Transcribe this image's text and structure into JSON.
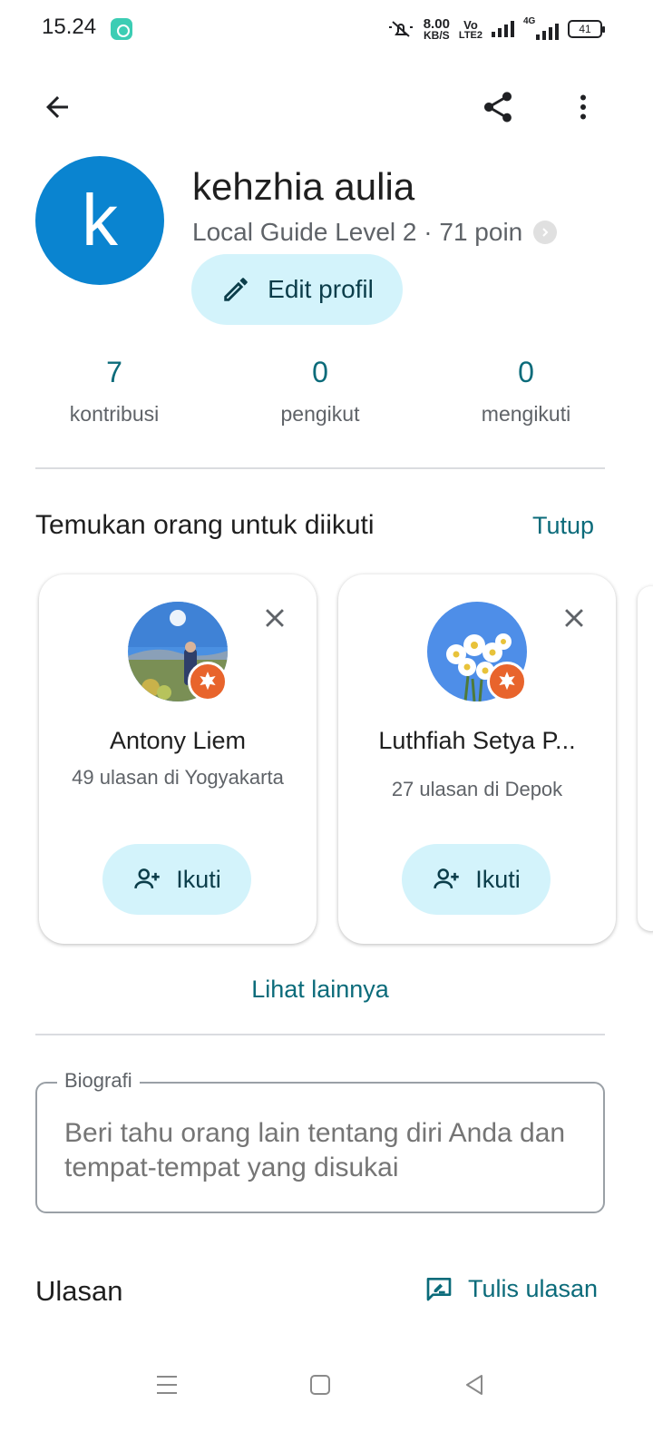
{
  "status_bar": {
    "time": "15.24",
    "net_speed_value": "8.00",
    "net_speed_unit": "KB/S",
    "volte_top": "Vo",
    "volte_bottom": "LTE2",
    "network_type": "4G",
    "battery": "41"
  },
  "profile": {
    "avatar_initial": "k",
    "name": "kehzhia aulia",
    "level": "Local Guide Level 2 · 71 poin",
    "edit_label": "Edit profil"
  },
  "stats": [
    {
      "value": "7",
      "label": "kontribusi"
    },
    {
      "value": "0",
      "label": "pengikut"
    },
    {
      "value": "0",
      "label": "mengikuti"
    }
  ],
  "suggestions": {
    "title": "Temukan orang untuk diikuti",
    "close_label": "Tutup",
    "more_label": "Lihat lainnya",
    "cards": [
      {
        "name": "Antony Liem",
        "subtitle": "49 ulasan di Yogyakarta",
        "follow_label": "Ikuti"
      },
      {
        "name": "Luthfiah Setya P...",
        "subtitle": "27 ulasan di Depok",
        "follow_label": "Ikuti"
      }
    ]
  },
  "bio": {
    "legend": "Biografi",
    "placeholder": "Beri tahu orang lain tentang diri Anda dan tempat-tempat yang disukai"
  },
  "reviews": {
    "title": "Ulasan",
    "write_label": "Tulis ulasan"
  },
  "colors": {
    "accent": "#0b6b7a",
    "chip_bg": "#d3f3fb",
    "avatar_bg": "#0a84d0",
    "badge": "#e8642c"
  },
  "icons": [
    "back-arrow-icon",
    "share-icon",
    "more-vert-icon",
    "pencil-icon",
    "chevron-right-icon",
    "close-icon",
    "person-add-icon",
    "rate-review-icon",
    "menu-icon",
    "home-square-icon",
    "back-triangle-icon"
  ]
}
